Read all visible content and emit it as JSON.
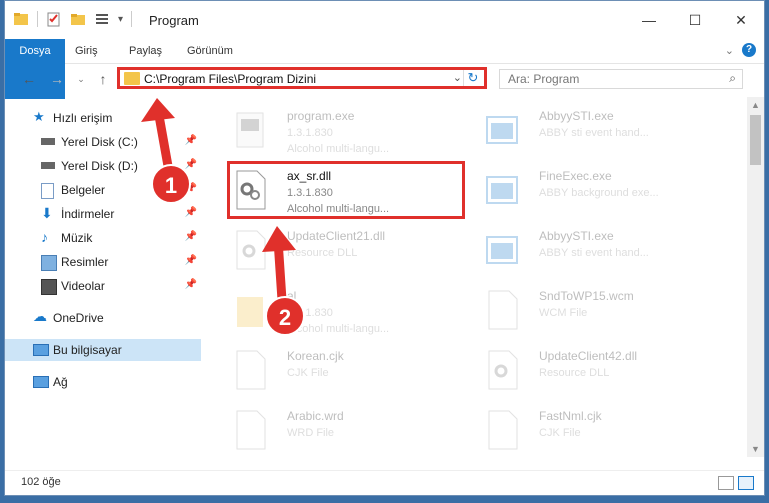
{
  "title": "Program",
  "ribbon": {
    "tabs": [
      "Dosya",
      "Giriş",
      "Paylaş",
      "Görünüm"
    ]
  },
  "nav": {
    "address": "C:\\Program Files\\Program Dizini",
    "search_placeholder": "Ara: Program"
  },
  "sidebar": {
    "items": [
      {
        "label": "Hızlı erişim",
        "icon": "star-icon"
      },
      {
        "label": "Yerel Disk (C:)",
        "icon": "drive-icon"
      },
      {
        "label": "Yerel Disk (D:)",
        "icon": "drive-icon"
      },
      {
        "label": "Belgeler",
        "icon": "documents-icon"
      },
      {
        "label": "İndirmeler",
        "icon": "download-icon"
      },
      {
        "label": "Müzik",
        "icon": "music-icon"
      },
      {
        "label": "Resimler",
        "icon": "pictures-icon"
      },
      {
        "label": "Videolar",
        "icon": "videos-icon"
      },
      {
        "label": "OneDrive",
        "icon": "cloud-icon"
      },
      {
        "label": "Bu bilgisayar",
        "icon": "computer-icon"
      },
      {
        "label": "Ağ",
        "icon": "network-icon"
      }
    ]
  },
  "files": [
    {
      "name": "program.exe",
      "line2": "1.3.1.830",
      "line3": "Alcohol multi-langu..."
    },
    {
      "name": "AbbyySTI.exe",
      "line2": "ABBY sti event hand...",
      "line3": ""
    },
    {
      "name": "ax_sr.dll",
      "line2": "1.3.1.830",
      "line3": "Alcohol multi-langu..."
    },
    {
      "name": "FineExec.exe",
      "line2": "ABBY background exe...",
      "line3": ""
    },
    {
      "name": "UpdateClient21.dll",
      "line2": "Resource DLL",
      "line3": ""
    },
    {
      "name": "AbbyySTI.exe",
      "line2": "ABBY sti event hand...",
      "line3": ""
    },
    {
      "name": "al",
      "line2": "1.3.1.830",
      "line3": "Alcohol multi-langu..."
    },
    {
      "name": "SndToWP15.wcm",
      "line2": "WCM File",
      "line3": ""
    },
    {
      "name": "Korean.cjk",
      "line2": "CJK File",
      "line3": ""
    },
    {
      "name": "UpdateClient42.dll",
      "line2": "Resource DLL",
      "line3": ""
    },
    {
      "name": "Arabic.wrd",
      "line2": "WRD File",
      "line3": ""
    },
    {
      "name": "FastNml.cjk",
      "line2": "CJK File",
      "line3": ""
    }
  ],
  "status": {
    "count": "102 öğe"
  },
  "callouts": [
    "1",
    "2"
  ],
  "colors": {
    "accent": "#1979ca",
    "annotation": "#e0302b"
  }
}
